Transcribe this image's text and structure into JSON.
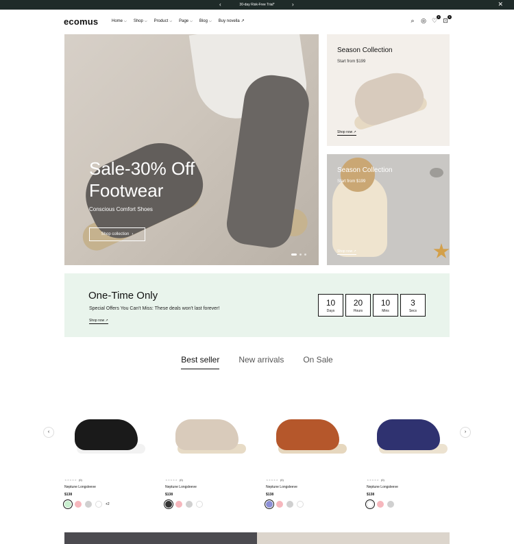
{
  "announcement": {
    "prev": "‹",
    "text": "30-day Risk-Free Trial*",
    "next": "›",
    "close": "✕"
  },
  "header": {
    "logo": "ecomus",
    "nav": [
      {
        "label": "Home",
        "has_dropdown": true
      },
      {
        "label": "Shop",
        "has_dropdown": true
      },
      {
        "label": "Product",
        "has_dropdown": true
      },
      {
        "label": "Page",
        "has_dropdown": true
      },
      {
        "label": "Blog",
        "has_dropdown": true
      },
      {
        "label": "Buy novella",
        "icon": "arrow-up-right-icon"
      }
    ],
    "icons": {
      "search": "⌕",
      "account": "◎",
      "wishlist": "♡",
      "wishlist_count": "0",
      "cart": "⊡",
      "cart_count": "0"
    }
  },
  "hero": {
    "title_line1": "Sale-30% Off",
    "title_line2": "Footwear",
    "subtitle": "Conscious Comfort Shoes",
    "button": "Shop collection",
    "button_icon": "›",
    "slide_count": 3,
    "active_slide": 1
  },
  "banners": [
    {
      "title": "Season Collection",
      "subtitle": "Start from $199",
      "link": "Shop now ↗"
    },
    {
      "title": "Season Collection",
      "subtitle": "Start from $199",
      "link": "Shop now ↗"
    }
  ],
  "promo": {
    "title": "One-Time Only",
    "text": "Special Offers You Can't Miss: These deals won't last forever!",
    "link": "Shop now ↗",
    "countdown": [
      {
        "value": "10",
        "label": "Days"
      },
      {
        "value": "20",
        "label": "Hours"
      },
      {
        "value": "10",
        "label": "Mins"
      },
      {
        "value": "3",
        "label": "Secs"
      }
    ]
  },
  "tabs": [
    {
      "label": "Best seller",
      "active": true
    },
    {
      "label": "New arrivals",
      "active": false
    },
    {
      "label": "On Sale",
      "active": false
    }
  ],
  "carousel": {
    "prev": "‹",
    "next": "›"
  },
  "products": [
    {
      "stars": "★★★★★",
      "reviews": "(0)",
      "name": "Neptune Longsleeve",
      "price": "$138",
      "shoe_color": "#1a1a1a",
      "sole_color": "#f2f2f2",
      "swatches": [
        "#c9efcf",
        "#f6b7bd",
        "#d0d0d0",
        "#ffffff"
      ],
      "selected": 0,
      "more": "+2"
    },
    {
      "stars": "★★★★★",
      "reviews": "(0)",
      "name": "Neptune Longsleeve",
      "price": "$138",
      "shoe_color": "#d9cbbb",
      "sole_color": "#e7dbc6",
      "swatches": [
        "#333333",
        "#f6b7bd",
        "#d0d0d0",
        "#ffffff"
      ],
      "selected": 0,
      "more": ""
    },
    {
      "stars": "★★★★★",
      "reviews": "(0)",
      "name": "Neptune Longsleeve",
      "price": "$138",
      "shoe_color": "#b5572b",
      "sole_color": "#e6d7be",
      "swatches": [
        "#8c8fd6",
        "#f6b7bd",
        "#d0d0d0",
        "#ffffff"
      ],
      "selected": 0,
      "more": ""
    },
    {
      "stars": "★★★★★",
      "reviews": "(0)",
      "name": "Neptune Longsleeve",
      "price": "$138",
      "shoe_color": "#2f3270",
      "sole_color": "#ece2d0",
      "swatches": [
        "#ffffff",
        "#f6b7bd",
        "#d0d0d0"
      ],
      "selected": 0,
      "more": ""
    }
  ]
}
